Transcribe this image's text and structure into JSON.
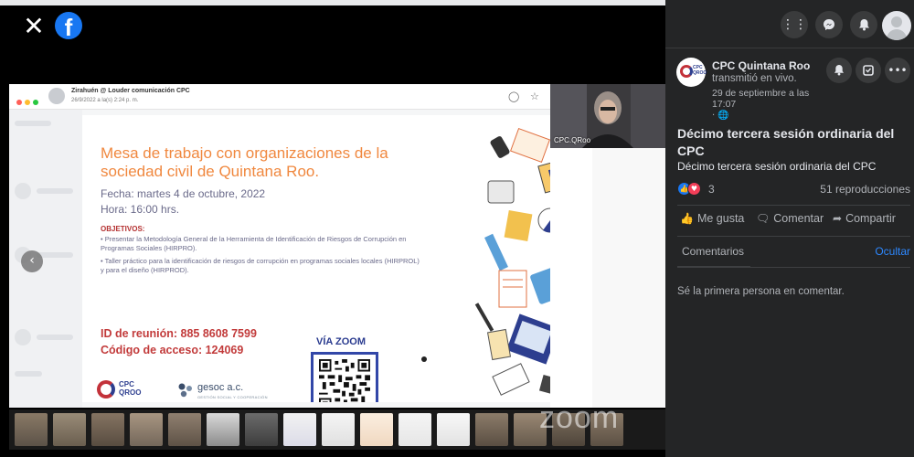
{
  "viewer": {
    "close_icon": "close-icon",
    "logo": "facebook-logo"
  },
  "meeting_header": {
    "sender": "Zirahuén @ Louder comunicación CPC",
    "date": "26/9/2022 a la(s) 2:24 p. m."
  },
  "slide": {
    "title": "Mesa de trabajo con organizaciones de la sociedad civil de Quintana Roo.",
    "date": "Fecha: martes 4 de octubre, 2022",
    "time": "Hora: 16:00 hrs.",
    "objectives_heading": "OBJETIVOS:",
    "objective_1": "• Presentar la Metodología General de la Herramienta de Identificación de Riesgos de Corrupción en Programas Sociales (HIRPRO).",
    "objective_2": "• Taller práctico para la identificación de riesgos de corrupción en programas sociales locales (HIRPROL) y para el diseño (HIRPROD).",
    "meeting_id": "ID de reunión: 885 8608 7599",
    "access_code": "Código de acceso: 124069",
    "via_zoom": "VÍA ZOOM",
    "logo_cpc_line1": "CPC",
    "logo_cpc_line2": "QROO",
    "logo_gesoc": "gesoc a.c.",
    "logo_gesoc_sub": "GESTIÓN SOCIAL Y COOPERACIÓN"
  },
  "camera": {
    "label": "CPC.QRoo"
  },
  "watermark": "zoom",
  "topbar": {
    "menu_icon": "grid-menu-icon",
    "messenger_icon": "messenger-icon",
    "notifications_icon": "bell-icon",
    "profile": "profile-avatar"
  },
  "post": {
    "page_name": "CPC Quintana Roo",
    "action_text": "transmitió en vivo.",
    "date": "29 de septiembre a las 17:07",
    "privacy": "· 🌐",
    "title": "Décimo tercera sesión ordinaria del CPC",
    "description": "Décimo tercera sesión ordinaria del CPC",
    "reaction_count": "3",
    "views": "51 reproducciones",
    "like_label": "Me gusta",
    "comment_label": "Comentar",
    "share_label": "Compartir",
    "comments_tab": "Comentarios",
    "hide_label": "Ocultar",
    "empty_comments": "Sé la primera persona en comentar."
  },
  "colors": {
    "facebook_blue": "#1877f2",
    "panel_bg": "#242526",
    "slide_title_orange": "#f0883f",
    "slide_red": "#c23b3b",
    "zoom_blue": "#2a3b8f"
  }
}
